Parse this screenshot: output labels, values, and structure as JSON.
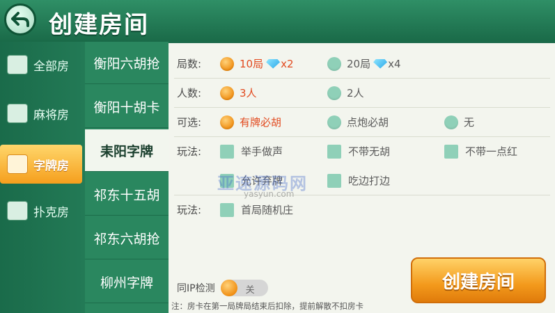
{
  "header": {
    "title": "创建房间"
  },
  "categories": [
    {
      "label": "全部房",
      "active": false
    },
    {
      "label": "麻将房",
      "active": false
    },
    {
      "label": "字牌房",
      "active": true
    },
    {
      "label": "扑克房",
      "active": false
    }
  ],
  "games": [
    {
      "label": "衡阳六胡抢"
    },
    {
      "label": "衡阳十胡卡"
    },
    {
      "label": "耒阳字牌"
    },
    {
      "label": "祁东十五胡"
    },
    {
      "label": "祁东六胡抢"
    },
    {
      "label": "柳州字牌"
    }
  ],
  "rules": {
    "rounds": {
      "label": "局数:",
      "opt1_text": "10局",
      "opt1_mult": "x2",
      "opt2_text": "20局",
      "opt2_mult": "x4"
    },
    "players": {
      "label": "人数:",
      "opt1": "3人",
      "opt2": "2人"
    },
    "optional": {
      "label": "可选:",
      "opt1": "有牌必胡",
      "opt2": "点炮必胡",
      "opt3": "无"
    },
    "play1": {
      "label": "玩法:",
      "opt1": "举手做声",
      "opt2": "不带无胡",
      "opt3": "不带一点红",
      "opt4": "允许弃牌",
      "opt5": "吃边打边"
    },
    "play2": {
      "label": "玩法:",
      "opt1": "首局随机庄"
    }
  },
  "ip_check": {
    "label": "同IP检测",
    "state": "关"
  },
  "note": "注：房卡在第一局牌局结束后扣除，提前解散不扣房卡",
  "create_button": "创建房间",
  "watermark": {
    "text": "亚速源码网",
    "url": "yasyun.com"
  },
  "colors": {
    "accent": "#f39a1c",
    "selected_text": "#e24a1f",
    "radio_off": "#8fd0b8",
    "header_bg": "#1a6a48"
  }
}
